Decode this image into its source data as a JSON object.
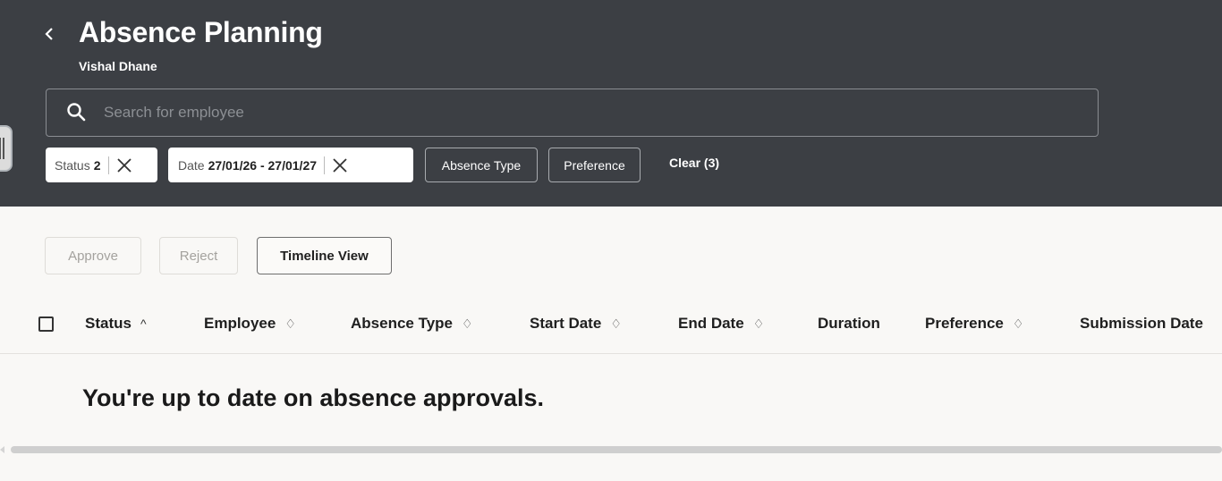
{
  "header": {
    "title": "Absence Planning",
    "subtitle": "Vishal Dhane",
    "back_icon": "chevron-left-icon"
  },
  "search": {
    "placeholder": "Search for employee",
    "value": "",
    "icon": "search-icon"
  },
  "filters": {
    "status": {
      "label": "Status",
      "value": "2"
    },
    "date": {
      "label": "Date",
      "value": "27/01/26 - 27/01/27"
    },
    "absence_type": "Absence Type",
    "preference": "Preference",
    "clear": "Clear (3)"
  },
  "toolbar": {
    "approve": "Approve",
    "reject": "Reject",
    "timeline_view": "Timeline View"
  },
  "table": {
    "columns": [
      {
        "label": "Status",
        "sort": "^"
      },
      {
        "label": "Employee",
        "sort": "♢"
      },
      {
        "label": "Absence Type",
        "sort": "♢"
      },
      {
        "label": "Start Date",
        "sort": "♢"
      },
      {
        "label": "End Date",
        "sort": "♢"
      },
      {
        "label": "Duration",
        "sort": ""
      },
      {
        "label": "Preference",
        "sort": "♢"
      },
      {
        "label": "Submission Date",
        "sort": ""
      }
    ],
    "empty_message": "You're up to date on absence approvals."
  },
  "colors": {
    "header_bg": "#3c3f44",
    "page_bg": "#f9f8f6"
  }
}
